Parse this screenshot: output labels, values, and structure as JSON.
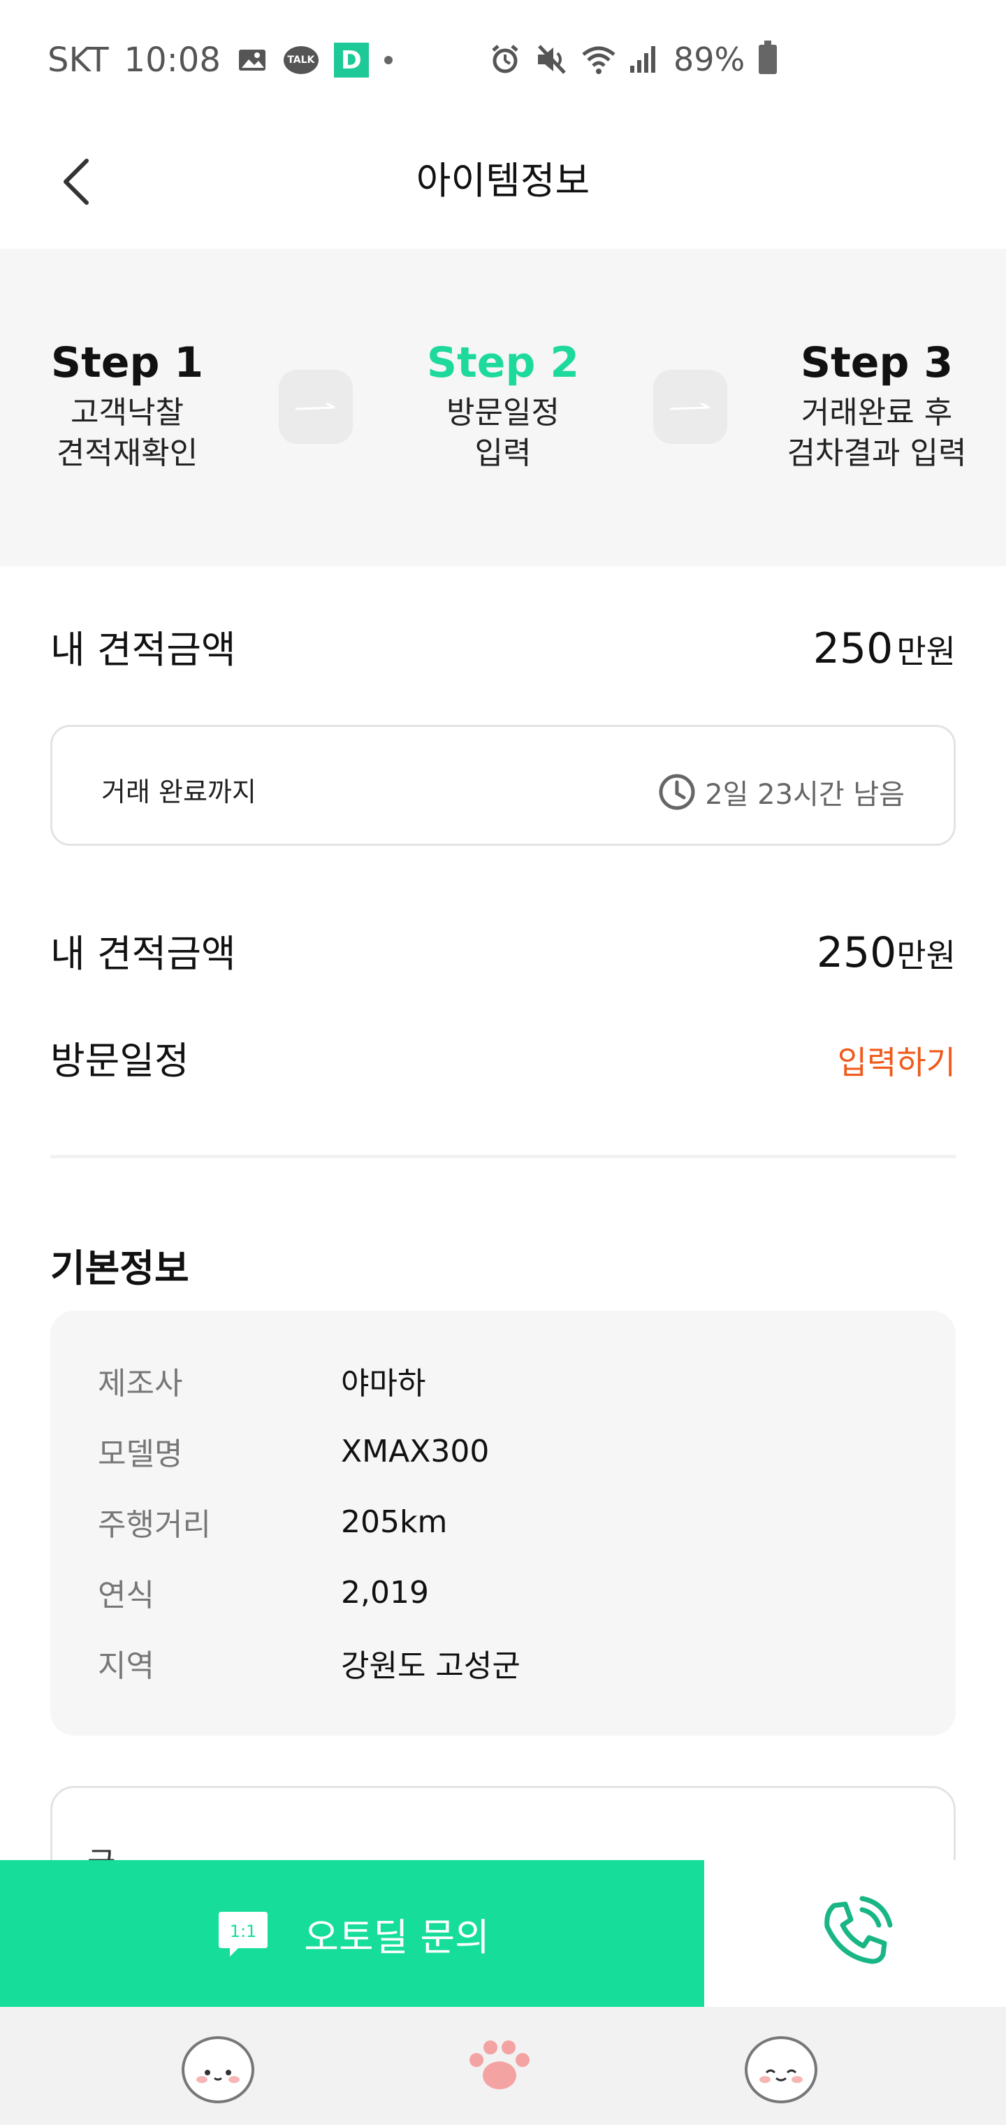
{
  "status_bar": {
    "carrier": "SKT",
    "time": "10:08",
    "talk_badge": "TALK",
    "d_badge": "D",
    "battery": "89%"
  },
  "header": {
    "title": "아이템정보"
  },
  "steps": [
    {
      "title": "Step 1",
      "line1": "고객낙찰",
      "line2": "견적재확인"
    },
    {
      "title": "Step 2",
      "line1": "방문일정",
      "line2": "입력"
    },
    {
      "title": "Step 3",
      "line1": "거래완료 후",
      "line2": "검차결과 입력"
    }
  ],
  "quote_top": {
    "label": "내 견적금액",
    "amount": "250",
    "unit": "만원"
  },
  "countdown": {
    "label": "거래 완료까지",
    "remaining": "2일 23시간 남음"
  },
  "quote_detail": {
    "label": "내 견적금액",
    "amount": "250",
    "unit": "만원"
  },
  "visit": {
    "label": "방문일정",
    "action": "입력하기"
  },
  "basic_info": {
    "title": "기본정보",
    "rows": [
      {
        "label": "제조사",
        "value": "야마하"
      },
      {
        "label": "모델명",
        "value": "XMAX300"
      },
      {
        "label": "주행거리",
        "value": "205km"
      },
      {
        "label": "연식",
        "value": "2,019"
      },
      {
        "label": "지역",
        "value": "강원도 고성군"
      }
    ]
  },
  "memo": {
    "label": "글"
  },
  "bottom_bar": {
    "inquiry_label": "오토딜 문의",
    "chat_badge": "1:1"
  },
  "colors": {
    "accent": "#16de9a",
    "action": "#f05a1a",
    "phone": "#18b585"
  }
}
